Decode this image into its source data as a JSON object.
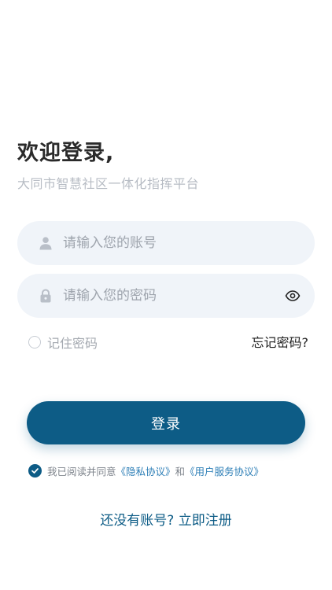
{
  "header": {
    "welcome": "欢迎登录,",
    "subtitle": "大同市智慧社区一体化指挥平台"
  },
  "form": {
    "account_placeholder": "请输入您的账号",
    "password_placeholder": "请输入您的密码",
    "remember_label": "记住密码",
    "forgot_label": "忘记密码?",
    "login_label": "登录"
  },
  "agreement": {
    "prefix": "我已阅读并同意",
    "privacy_link": "《隐私协议》",
    "and": "和",
    "service_link": "《用户服务协议》",
    "checked": true
  },
  "register": {
    "label": "还没有账号? 立即注册"
  },
  "icons": {
    "account": "user-icon",
    "password": "lock-icon",
    "visibility": "eye-icon",
    "agree": "check-icon"
  },
  "colors": {
    "primary": "#0d5c86",
    "link": "#2e7fb7",
    "field_bg": "#f0f4f9"
  }
}
